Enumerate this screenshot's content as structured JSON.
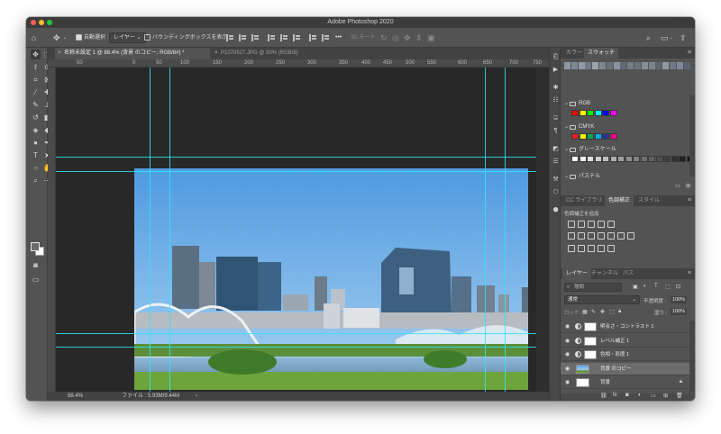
{
  "app": {
    "title": "Adobe Photoshop 2020"
  },
  "options_bar": {
    "home_icon": "home-icon",
    "move_icon": "move-tool-icon",
    "auto_select_label": "自動選択 :",
    "auto_select_checked": true,
    "auto_select_target": "レイヤー",
    "bounding_box_label": "バウンディングボックスを表示",
    "bounding_box_checked": false,
    "more": "•••",
    "mode_3d": "3D モード :"
  },
  "document_tabs": [
    {
      "label": "名称未設定 1 @ 88.4% (背景 のコピー, RGB/8#) *",
      "active": true
    },
    {
      "label": "P1070527.JPG @ 50% (RGB/8)",
      "active": false
    }
  ],
  "ruler": {
    "top_labels": [
      "50",
      "0",
      "50",
      "100",
      "150",
      "200",
      "250",
      "300",
      "350",
      "400",
      "450",
      "500",
      "550",
      "600",
      "650",
      "700",
      "750"
    ]
  },
  "status_bar": {
    "zoom": "88.4%",
    "file_info": "ファイル : 5.93M/9.44M",
    "arrow": "›"
  },
  "swatches_panel": {
    "tabs": [
      "カラー",
      "スウォッチ"
    ],
    "active_tab": "スウォッチ",
    "recent_colors": [
      "#8d99a4",
      "#7c8893",
      "#8e9aa5",
      "#6f7b86",
      "#9aa5af",
      "#7d8892",
      "#66727d",
      "#8a949d",
      "#5e6a75",
      "#727e88",
      "#6a7580",
      "#858f99",
      "#7a858f",
      "#5c6670",
      "#909aa3",
      "#6d7882",
      "#80899b",
      "#5a6570"
    ],
    "groups": [
      {
        "name": "RGB",
        "colors": [
          "#ff0000",
          "#ffff00",
          "#00ff00",
          "#00ffff",
          "#0000ff",
          "#ff00ff"
        ]
      },
      {
        "name": "CMYK",
        "colors": [
          "#ed1c24",
          "#fff200",
          "#00a651",
          "#00aeef",
          "#2e3192",
          "#ec008c"
        ]
      },
      {
        "name": "グレースケール",
        "colors": [
          "#ffffff",
          "#f0f0f0",
          "#e0e0e0",
          "#d0d0d0",
          "#c0c0c0",
          "#b0b0b0",
          "#a0a0a0",
          "#909090",
          "#808080",
          "#707070",
          "#606060",
          "#505050",
          "#404040",
          "#303030",
          "#202020",
          "#101010"
        ]
      },
      {
        "name": "パステル",
        "colors": []
      }
    ]
  },
  "adjustments_panel": {
    "tabs": [
      "CC ライブラリ",
      "色調補正",
      "スタイル"
    ],
    "active_tab": "色調補正",
    "add_label": "色調補正を追加"
  },
  "layers_panel": {
    "tabs": [
      "レイヤー",
      "チャンネル",
      "パス"
    ],
    "active_tab": "レイヤー",
    "filter_placeholder": "種類",
    "blend_mode": "通常",
    "opacity_label": "不透明度 :",
    "opacity_value": "100%",
    "lock_label": "ロック :",
    "fill_label": "塗り :",
    "fill_value": "100%",
    "layers": [
      {
        "name": "明るさ・コントラスト 1",
        "kind": "adjustment"
      },
      {
        "name": "レベル補正 1",
        "kind": "adjustment"
      },
      {
        "name": "色相・彩度 1",
        "kind": "adjustment"
      },
      {
        "name": "背景 のコピー",
        "kind": "image",
        "selected": true
      },
      {
        "name": "背景",
        "kind": "background",
        "locked": true
      }
    ],
    "footer_icons": [
      "link-icon",
      "fx-icon",
      "mask-icon",
      "adjustment-icon",
      "group-icon",
      "new-layer-icon",
      "trash-icon"
    ]
  }
}
